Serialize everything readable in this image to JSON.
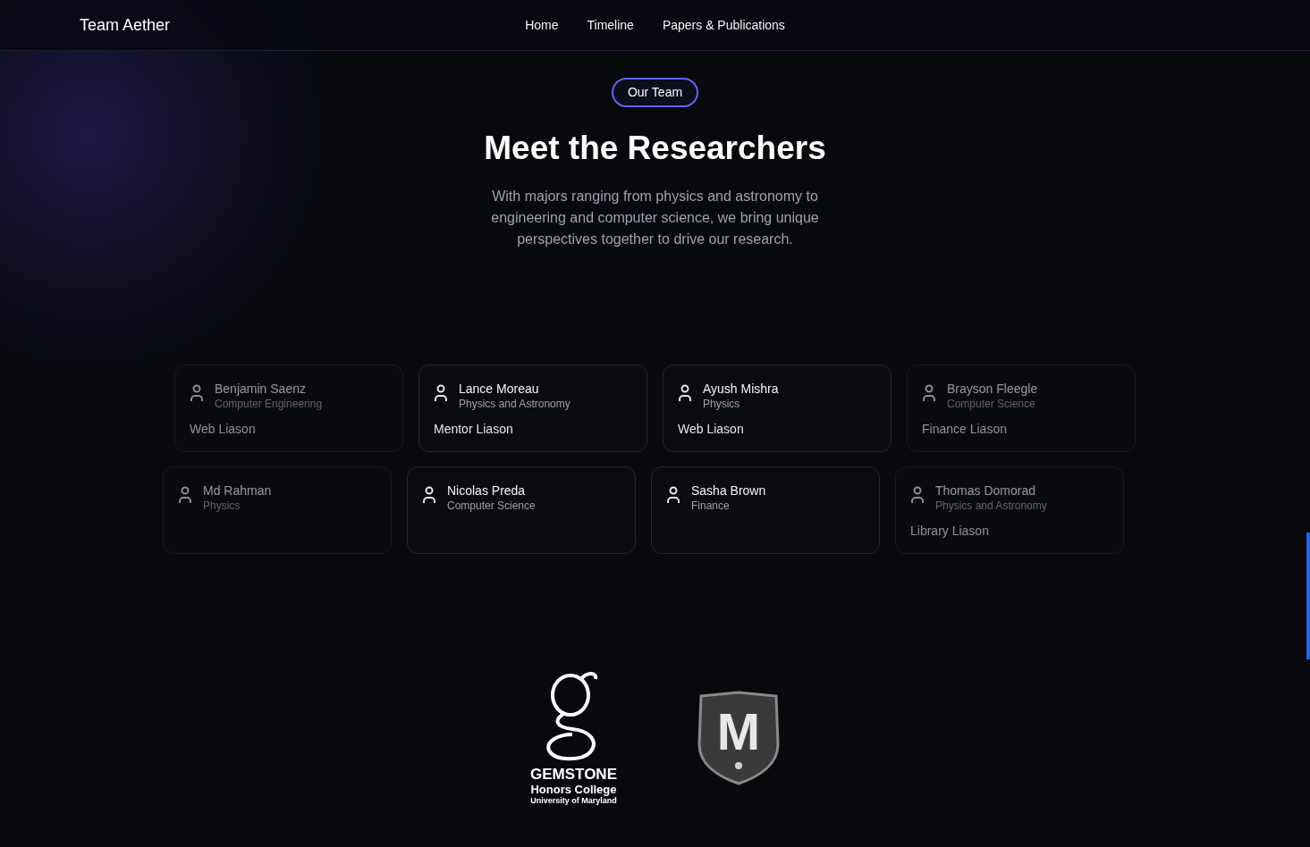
{
  "nav": {
    "brand": "Team Aether",
    "links": [
      "Home",
      "Timeline",
      "Papers & Publications"
    ]
  },
  "hero": {
    "badge": "Our Team",
    "title": "Meet the Researchers",
    "subtitle": "With majors ranging from physics and astronomy to engineering and computer science, we bring unique perspectives together to drive our research."
  },
  "rows": [
    [
      {
        "name": "Benjamin Saenz",
        "major": "Computer Engineering",
        "role": "Web Liason",
        "faded": true
      },
      {
        "name": "Lance Moreau",
        "major": "Physics and Astronomy",
        "role": "Mentor Liason",
        "faded": false
      },
      {
        "name": "Ayush Mishra",
        "major": "Physics",
        "role": "Web Liason",
        "faded": false
      },
      {
        "name": "Brayson Fleegle",
        "major": "Computer Science",
        "role": "Finance Liason",
        "faded": true
      }
    ],
    [
      {
        "name": "Md Rahman",
        "major": "Physics",
        "faded": true
      },
      {
        "name": "Nicolas Preda",
        "major": "Computer Science",
        "faded": false
      },
      {
        "name": "Sasha Brown",
        "major": "Finance",
        "faded": false
      },
      {
        "name": "Thomas Domorad",
        "major": "Physics and Astronomy",
        "role": "Library Liason",
        "faded": true
      }
    ]
  ],
  "logos": {
    "gemstone": {
      "title": "GEMSTONE",
      "line_1": "Honors College",
      "line_2": "University of Maryland"
    },
    "shield": {
      "letter": "M"
    }
  }
}
